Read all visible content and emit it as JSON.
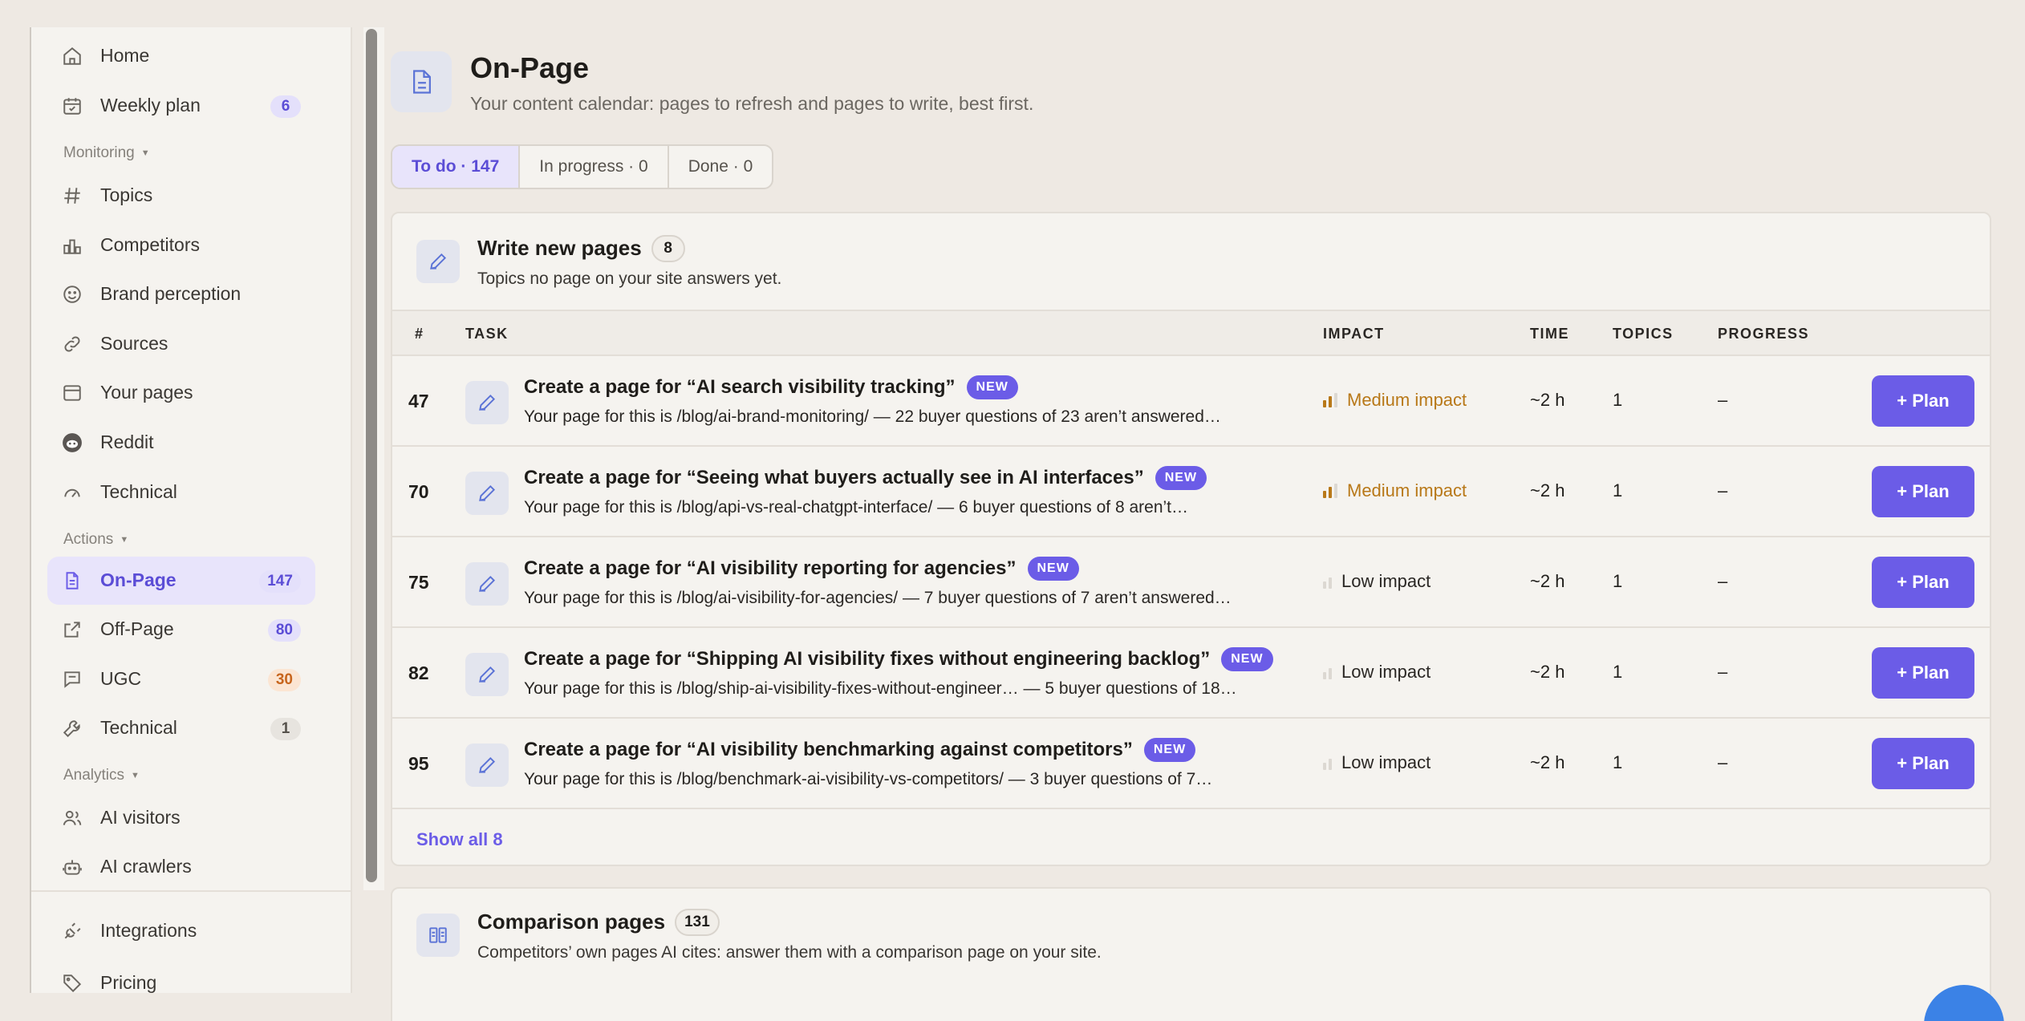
{
  "sidebar": {
    "items": [
      {
        "label": "Home",
        "icon": "home-icon"
      },
      {
        "label": "Weekly plan",
        "icon": "calendar-icon",
        "badge": "6"
      },
      {
        "label": "Topics",
        "icon": "hash-icon"
      },
      {
        "label": "Competitors",
        "icon": "bar-chart-icon"
      },
      {
        "label": "Brand perception",
        "icon": "smiley-icon"
      },
      {
        "label": "Sources",
        "icon": "link-icon"
      },
      {
        "label": "Your pages",
        "icon": "browser-window-icon"
      },
      {
        "label": "Reddit",
        "icon": "reddit-icon"
      },
      {
        "label": "Technical",
        "icon": "gauge-icon"
      },
      {
        "label": "On-Page",
        "icon": "document-icon",
        "badge": "147",
        "active": true
      },
      {
        "label": "Off-Page",
        "icon": "external-link-icon",
        "badge": "80"
      },
      {
        "label": "UGC",
        "icon": "chat-bubble-icon",
        "badge": "30"
      },
      {
        "label": "Technical",
        "icon": "wrench-icon",
        "badge": "1"
      },
      {
        "label": "AI visitors",
        "icon": "users-icon"
      },
      {
        "label": "AI crawlers",
        "icon": "robot-icon"
      },
      {
        "label": "Integrations",
        "icon": "plug-icon"
      },
      {
        "label": "Pricing",
        "icon": "tag-icon"
      }
    ],
    "sections": {
      "monitoring": "Monitoring",
      "actions": "Actions",
      "analytics": "Analytics"
    }
  },
  "header": {
    "title": "On-Page",
    "subtitle": "Your content calendar: pages to refresh and pages to write, best first."
  },
  "tabs": [
    {
      "label": "To do · 147",
      "active": true
    },
    {
      "label": "In progress · 0",
      "active": false
    },
    {
      "label": "Done · 0",
      "active": false
    }
  ],
  "write_card": {
    "title": "Write new pages",
    "count": "8",
    "subtitle": "Topics no page on your site answers yet.",
    "columns": {
      "num": "#",
      "task": "TASK",
      "impact": "IMPACT",
      "time": "TIME",
      "topics": "TOPICS",
      "progress": "PROGRESS"
    },
    "rows": [
      {
        "num": "47",
        "title": "Create a page for “AI search visibility tracking”",
        "badge": "NEW",
        "desc": "Your page for this is /blog/ai-brand-monitoring/ — 22 buyer questions of 23 aren’t answered…",
        "impact": "Medium impact",
        "impact_level": "medium",
        "time": "~2 h",
        "topics": "1",
        "progress": "–",
        "action": "+ Plan"
      },
      {
        "num": "70",
        "title": "Create a page for “Seeing what buyers actually see in AI interfaces”",
        "badge": "NEW",
        "desc": "Your page for this is /blog/api-vs-real-chatgpt-interface/ — 6 buyer questions of 8 aren’t…",
        "impact": "Medium impact",
        "impact_level": "medium",
        "time": "~2 h",
        "topics": "1",
        "progress": "–",
        "action": "+ Plan"
      },
      {
        "num": "75",
        "title": "Create a page for “AI visibility reporting for agencies”",
        "badge": "NEW",
        "desc": "Your page for this is /blog/ai-visibility-for-agencies/ — 7 buyer questions of 7 aren’t answered…",
        "impact": "Low impact",
        "impact_level": "low",
        "time": "~2 h",
        "topics": "1",
        "progress": "–",
        "action": "+ Plan"
      },
      {
        "num": "82",
        "title": "Create a page for “Shipping AI visibility fixes without engineering backlog”",
        "badge": "NEW",
        "desc": "Your page for this is /blog/ship-ai-visibility-fixes-without-engineer… — 5 buyer questions of 18…",
        "impact": "Low impact",
        "impact_level": "low",
        "time": "~2 h",
        "topics": "1",
        "progress": "–",
        "action": "+ Plan"
      },
      {
        "num": "95",
        "title": "Create a page for “AI visibility benchmarking against competitors”",
        "badge": "NEW",
        "desc": "Your page for this is /blog/benchmark-ai-visibility-vs-competitors/ — 3 buyer questions of 7…",
        "impact": "Low impact",
        "impact_level": "low",
        "time": "~2 h",
        "topics": "1",
        "progress": "–",
        "action": "+ Plan"
      }
    ],
    "show_all": "Show all 8"
  },
  "comparison_card": {
    "title": "Comparison pages",
    "count": "131",
    "subtitle": "Competitors’ own pages AI cites: answer them with a comparison page on your site."
  },
  "colors": {
    "accent": "#6b5ce7",
    "medium_impact": "#b87818",
    "background": "#eee9e3"
  }
}
